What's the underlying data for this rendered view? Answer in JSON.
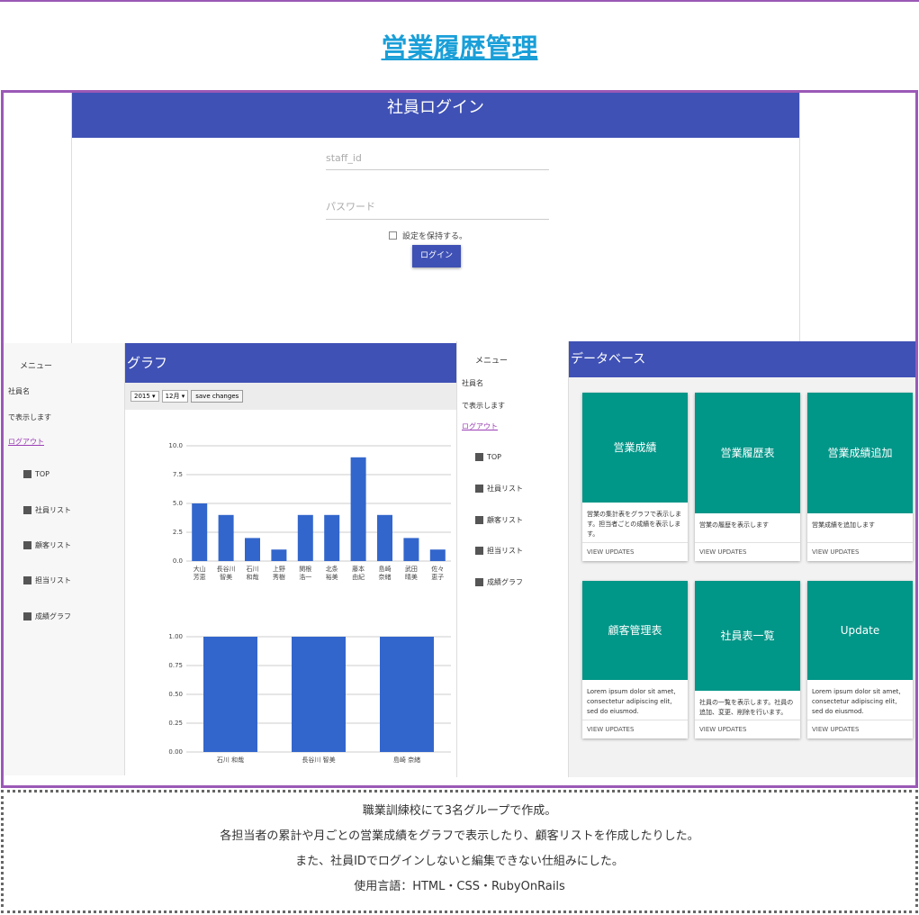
{
  "page_title": "営業履歴管理",
  "login": {
    "header": "社員ログイン",
    "staff_id_placeholder": "staff_id",
    "password_placeholder": "パスワード",
    "remember_label": "設定を保持する。",
    "login_button": "ログイン"
  },
  "graph_screen": {
    "menu": {
      "title": "メニュー",
      "user_name": "社員名",
      "logged_in": "で表示します",
      "logout": "ログアウト",
      "items": [
        {
          "label": "TOP",
          "icon": "bank-icon"
        },
        {
          "label": "社員リスト",
          "icon": "building-icon"
        },
        {
          "label": "顧客リスト",
          "icon": "contact-icon"
        },
        {
          "label": "担当リスト",
          "icon": "people-icon"
        },
        {
          "label": "成績グラフ",
          "icon": "chart-icon"
        }
      ]
    },
    "header": "グラフ",
    "toolbar": {
      "year": "2015",
      "month": "12月",
      "save": "save changes"
    },
    "chart_data": [
      {
        "type": "bar",
        "categories": [
          "大山\n芳恵",
          "長谷川\n智美",
          "石川\n和哉",
          "上野\n秀樹",
          "関根\n浩一",
          "北条\n裕美",
          "藤本\n由紀",
          "島崎\n奈緒",
          "武田\n晴美",
          "佐々\n恵子"
        ],
        "values": [
          5,
          4,
          2,
          1,
          4,
          4,
          9,
          4,
          2,
          1
        ],
        "ylim": [
          0,
          10
        ],
        "yticks": [
          "0.0",
          "2.5",
          "5.0",
          "7.5",
          "10.0"
        ],
        "color": "#3366cc"
      },
      {
        "type": "bar",
        "categories": [
          "石川 和哉",
          "長谷川 智美",
          "島崎 奈緒"
        ],
        "values": [
          1,
          1,
          1
        ],
        "ylim": [
          0,
          1
        ],
        "yticks": [
          "0.00",
          "0.25",
          "0.50",
          "0.75",
          "1.00"
        ],
        "color": "#3366cc"
      }
    ]
  },
  "dash_screen": {
    "menu": {
      "title": "メニュー",
      "user_name": "社員名",
      "logged_in": "で表示します",
      "logout": "ログアウト",
      "items": [
        {
          "label": "TOP",
          "icon": "bank-icon"
        },
        {
          "label": "社員リスト",
          "icon": "building-icon"
        },
        {
          "label": "顧客リスト",
          "icon": "contact-icon"
        },
        {
          "label": "担当リスト",
          "icon": "people-icon"
        },
        {
          "label": "成績グラフ",
          "icon": "chart-icon"
        }
      ]
    },
    "header": "データベース",
    "cards": [
      {
        "title": "営業成績",
        "desc": "営業の集計表をグラフで表示します。担当者ごとの成績を表示します。",
        "link": "VIEW UPDATES"
      },
      {
        "title": "営業履歴表",
        "desc": "営業の履歴を表示します",
        "link": "VIEW UPDATES"
      },
      {
        "title": "営業成績追加",
        "desc": "営業成績を追加します",
        "link": "VIEW UPDATES"
      },
      {
        "title": "顧客管理表",
        "desc": "Lorem ipsum dolor sit amet, consectetur adipiscing elit, sed do eiusmod.",
        "link": "VIEW UPDATES"
      },
      {
        "title": "社員表一覧",
        "desc": "社員の一覧を表示します。社員の追加、変更、削除を行います。",
        "link": "VIEW UPDATES"
      },
      {
        "title": "Update",
        "desc": "Lorem ipsum dolor sit amet, consectetur adipiscing elit, sed do eiusmod.",
        "link": "VIEW UPDATES"
      }
    ]
  },
  "description": [
    "職業訓練校にて3名グループで作成。",
    "各担当者の累計や月ごとの営業成績をグラフで表示したり、顧客リストを作成したりした。",
    "また、社員IDでログインしないと編集できない仕組みにした。",
    "使用言語：HTML・CSS・RubyOnRails"
  ]
}
